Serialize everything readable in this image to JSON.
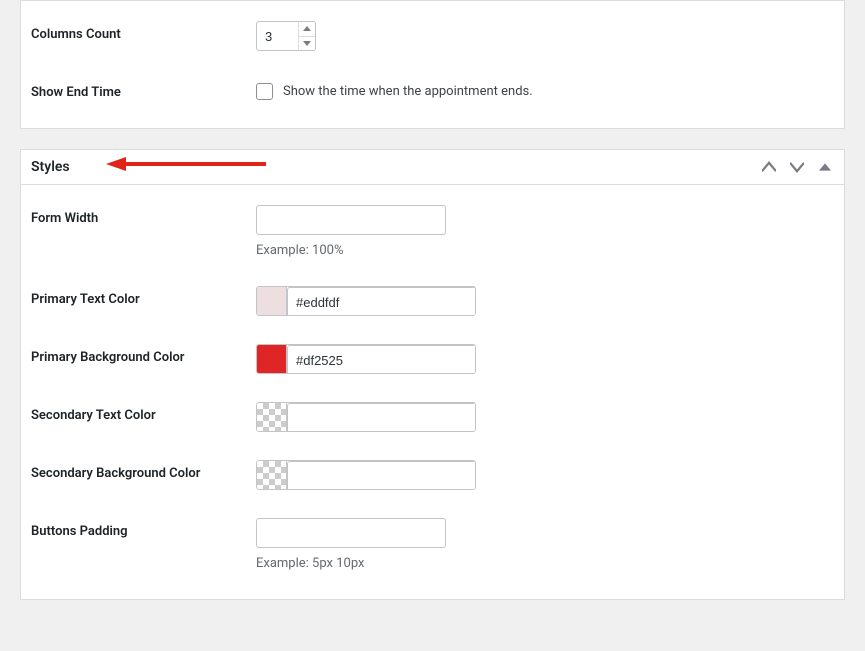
{
  "top": {
    "columns_label": "Columns Count",
    "columns_value": "3",
    "show_end_label": "Show End Time",
    "show_end_desc": "Show the time when the appointment ends."
  },
  "styles": {
    "title": "Styles",
    "form_width_label": "Form Width",
    "form_width_value": "",
    "form_width_hint": "Example: 100%",
    "primary_text_label": "Primary Text Color",
    "primary_text_value": "#eddfdf",
    "primary_text_swatch": "#eddfdf",
    "primary_bg_label": "Primary Background Color",
    "primary_bg_value": "#df2525",
    "primary_bg_swatch": "#df2525",
    "secondary_text_label": "Secondary Text Color",
    "secondary_text_value": "",
    "secondary_bg_label": "Secondary Background Color",
    "secondary_bg_value": "",
    "buttons_padding_label": "Buttons Padding",
    "buttons_padding_value": "",
    "buttons_padding_hint": "Example: 5px 10px"
  }
}
